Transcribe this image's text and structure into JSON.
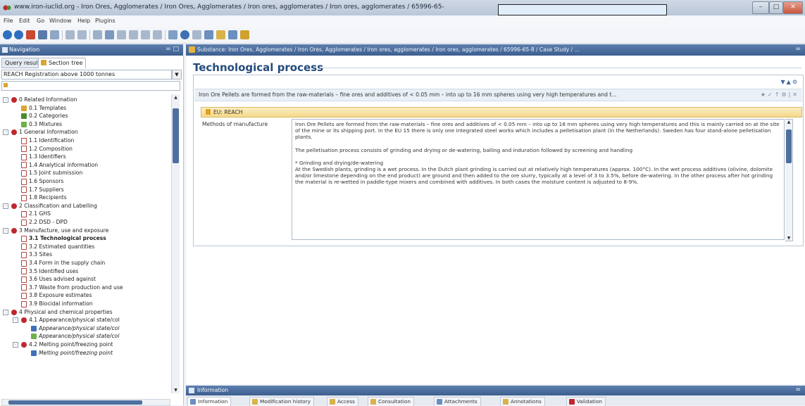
{
  "window": {
    "title": "www.iron-iuclid.org - Iron Ores, Agglomerates / Iron Ores, Agglomerates / Iron ores, agglomerates  / Iron ores, agglomerates  / 65996-65-"
  },
  "menu": [
    "File",
    "Edit",
    "Go",
    "Window",
    "Help",
    "Plugins"
  ],
  "navigation": {
    "header": "Navigation",
    "tabs": [
      "Query results",
      "Section tree"
    ],
    "filter_value": "REACH Registration above 1000 tonnes",
    "tree": [
      {
        "label": "0 Related Information",
        "level": 0,
        "kind": "root",
        "expander": "-"
      },
      {
        "label": "0.1 Templates",
        "level": 1,
        "kind": "template"
      },
      {
        "label": "0.2 Categories",
        "level": 1,
        "kind": "category"
      },
      {
        "label": "0.3 Mixtures",
        "level": 1,
        "kind": "mixture"
      },
      {
        "label": "1 General Information",
        "level": 0,
        "kind": "root",
        "expander": "-"
      },
      {
        "label": "1.1 Identification",
        "level": 1,
        "kind": "doc"
      },
      {
        "label": "1.2 Composition",
        "level": 1,
        "kind": "doc"
      },
      {
        "label": "1.3 Identifiers",
        "level": 1,
        "kind": "doc"
      },
      {
        "label": "1.4 Analytical information",
        "level": 1,
        "kind": "doc"
      },
      {
        "label": "1.5 Joint submission",
        "level": 1,
        "kind": "doc"
      },
      {
        "label": "1.6 Sponsors",
        "level": 1,
        "kind": "doc"
      },
      {
        "label": "1.7 Suppliers",
        "level": 1,
        "kind": "doc"
      },
      {
        "label": "1.8 Recipients",
        "level": 1,
        "kind": "doc"
      },
      {
        "label": "2 Classification and Labelling",
        "level": 0,
        "kind": "root",
        "expander": "-"
      },
      {
        "label": "2.1 GHS",
        "level": 1,
        "kind": "doc"
      },
      {
        "label": "2.2 DSD - DPD",
        "level": 1,
        "kind": "doc"
      },
      {
        "label": "3 Manufacture, use and exposure",
        "level": 0,
        "kind": "root",
        "expander": "-"
      },
      {
        "label": "3.1 Technological process",
        "level": 1,
        "kind": "doc",
        "selected": true
      },
      {
        "label": "3.2 Estimated quantities",
        "level": 1,
        "kind": "doc"
      },
      {
        "label": "3.3 Sites",
        "level": 1,
        "kind": "doc"
      },
      {
        "label": "3.4 Form in the supply chain",
        "level": 1,
        "kind": "doc"
      },
      {
        "label": "3.5 Identified uses",
        "level": 1,
        "kind": "doc"
      },
      {
        "label": "3.6 Uses advised against",
        "level": 1,
        "kind": "doc"
      },
      {
        "label": "3.7 Waste from production and use",
        "level": 1,
        "kind": "doc"
      },
      {
        "label": "3.8 Exposure estimates",
        "level": 1,
        "kind": "doc"
      },
      {
        "label": "3.9 Biocidal information",
        "level": 1,
        "kind": "doc"
      },
      {
        "label": "4 Physical and chemical properties",
        "level": 0,
        "kind": "root",
        "expander": "-"
      },
      {
        "label": "4.1 Appearance/physical state/col",
        "level": 1,
        "kind": "root",
        "expander": "-"
      },
      {
        "label": "Appearance/physical state/col",
        "level": 2,
        "kind": "record",
        "italic": true
      },
      {
        "label": "Appearance/physical state/col",
        "level": 2,
        "kind": "record2",
        "italic": true
      },
      {
        "label": "4.2 Melting point/freezing point",
        "level": 1,
        "kind": "root",
        "expander": "-"
      },
      {
        "label": "Melting point/freezing point",
        "level": 2,
        "kind": "record",
        "italic": true
      }
    ]
  },
  "main": {
    "header": "Substance: Iron Ores, Agglomerates / Iron Ores, Agglomerates / Iron ores, agglomerates  / Iron ores, agglomerates  / 65996-65-8 / Case Study / ...",
    "section_title": "Technological process",
    "summary": "Iron Ore Pellets are formed from the raw-materials – fine ores and additives of < 0.05 mm – into up to 16 mm spheres using very high temperatures and t...",
    "regulation_label": "EU: REACH",
    "methods_label": "Methods of manufacture",
    "methods_text": [
      "Iron Ore Pellets are formed from the raw-materials – fine ores and additives of < 0.05 mm – into up to 16 mm spheres using very high temperatures and this is mainly carried on at the site of the mine or its shipping port. In the EU 15 there is only one integrated steel works which includes a pelletisation plant (in the Netherlands). Sweden has four stand-alone pelletisation plants.",
      "The pelletisation process consists of grinding and drying or de-watering, balling and induration followed by screening and handling",
      "* Grinding and drying/de-watering\nAt the Swedish plants, grinding is a wet process. In the Dutch plant grinding is carried out at relatively high temperatures (approx. 100°C). In the wet process additives (olivine, dolomite and/or limestone depending on the end product) are ground and then added to the ore slurry, typically at a level of 3 to 3.5%, before de-watering. In the other process after hot grinding the material is re-wetted in paddle-type mixers and combined with additives. In both cases the moisture content is adjusted to 8-9%."
    ]
  },
  "info_panel": {
    "header": "Information",
    "tabs": [
      "Information",
      "Modification history",
      "Access",
      "Consultation",
      "Attachments",
      "Annotations",
      "Validation"
    ]
  },
  "colors": {
    "accent_header": "#3d5f90",
    "section_title": "#244b7b",
    "reach_bar": "#f4d98a",
    "root_icon": "#c0272d"
  }
}
